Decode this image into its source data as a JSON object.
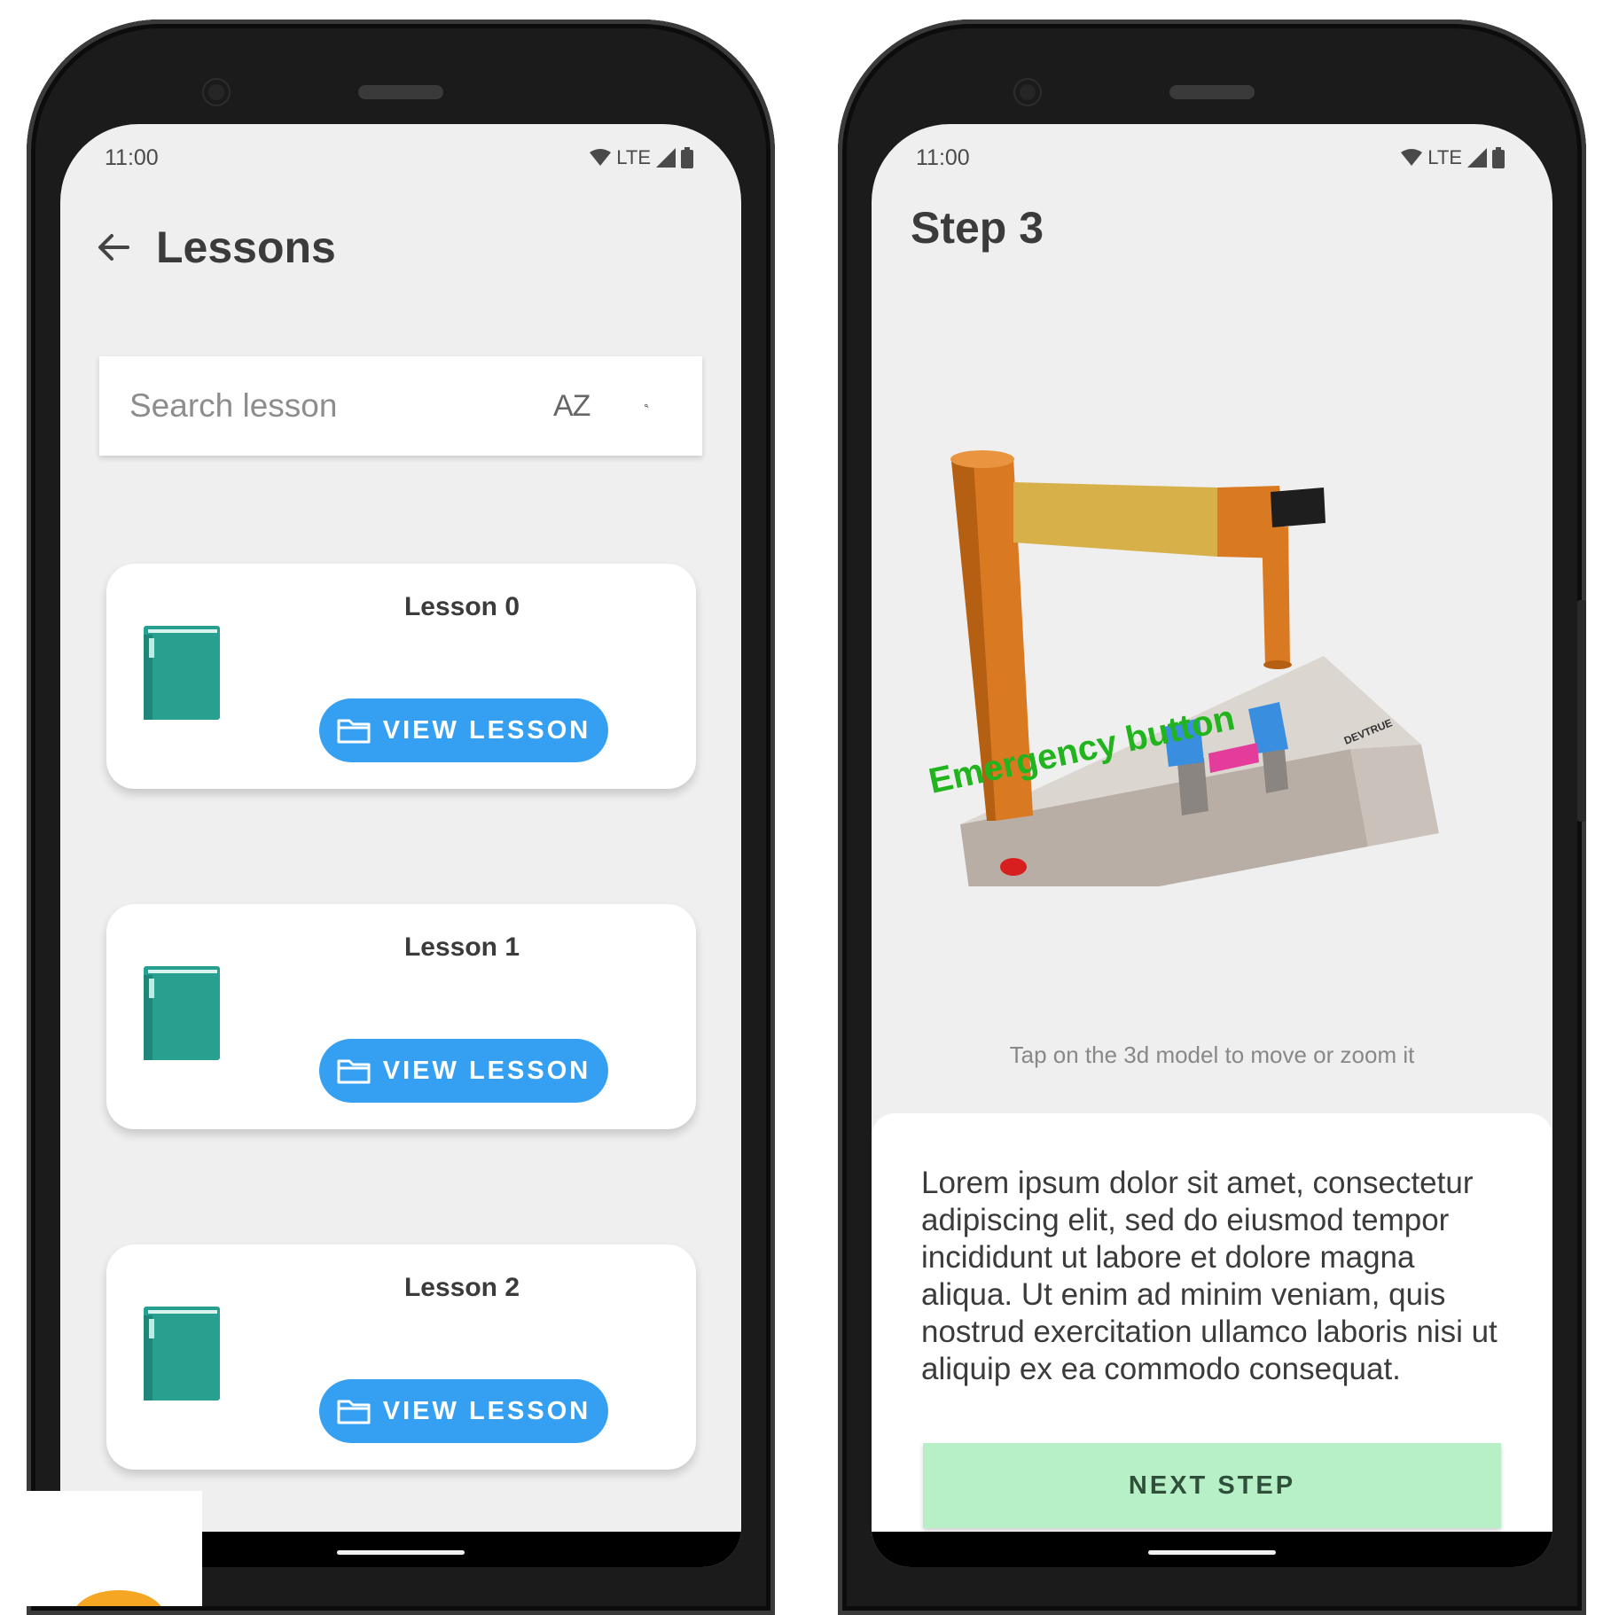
{
  "left_phone": {
    "status": {
      "time": "11:00",
      "network": "LTE"
    },
    "header": {
      "title": "Lessons"
    },
    "search": {
      "placeholder": "Search lesson",
      "sort_label": "AZ"
    },
    "lessons": [
      {
        "title": "Lesson 0",
        "button_label": "VIEW LESSON"
      },
      {
        "title": "Lesson 1",
        "button_label": "VIEW LESSON"
      },
      {
        "title": "Lesson 2",
        "button_label": "VIEW LESSON"
      }
    ]
  },
  "right_phone": {
    "status": {
      "time": "11:00",
      "network": "LTE"
    },
    "header": {
      "title": "Step 3"
    },
    "model": {
      "annotation": "Emergency button",
      "brand": "DEVTRUE"
    },
    "hint": "Tap on the 3d model to move or zoom it",
    "description": "Lorem ipsum dolor sit amet, consectetur adipiscing elit, sed do eiusmod tempor incididunt ut labore et dolore magna aliqua. Ut enim ad minim veniam, quis nostrud exercitation ullamco laboris nisi ut aliquip ex ea commodo consequat.",
    "next_button": "NEXT STEP"
  },
  "colors": {
    "accent_blue": "#35a0f2",
    "book_teal": "#27a08f",
    "next_green": "#b7f0c7",
    "annotation_green": "#22b41e",
    "robot_orange": "#d97a22"
  }
}
